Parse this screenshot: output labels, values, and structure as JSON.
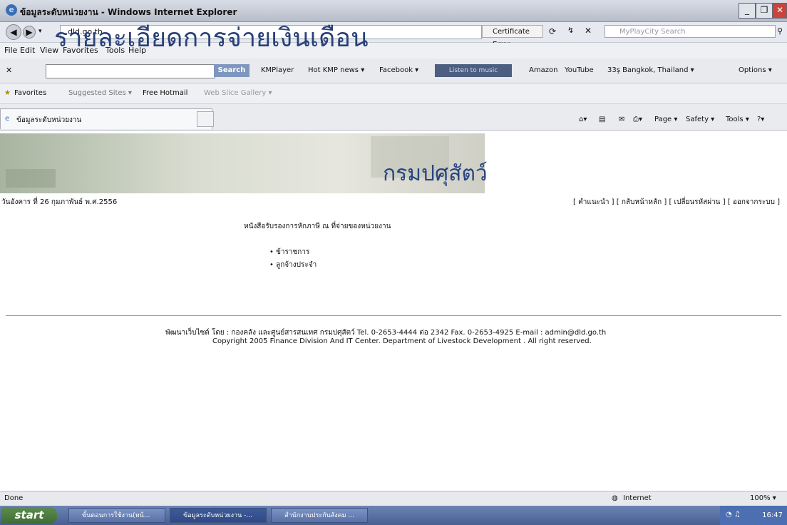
{
  "window": {
    "title": "ข้อมูลระดับหน่วยงาน - Windows Internet Explorer",
    "minimize": "_",
    "restore": "❐",
    "close": "✕"
  },
  "address_bar": {
    "url": "dld.go.th",
    "cert_error": "Certificate Error",
    "search_placeholder": "MyPlayCity Search"
  },
  "menu": [
    "File",
    "Edit",
    "View",
    "Favorites",
    "Tools",
    "Help"
  ],
  "toolbar": {
    "search_button": "Search",
    "items": [
      "KMPlayer",
      "Hot KMP news ▾",
      "Facebook ▾"
    ],
    "listen": "Listen to music",
    "items2": [
      "Amazon",
      "YouTube",
      "33ş Bangkok, Thailand ▾"
    ],
    "options": "Options ▾"
  },
  "favorites_bar": {
    "favorites": "Favorites",
    "suggested": "Suggested Sites ▾",
    "hotmail": "Free Hotmail",
    "gallery": "Web Slice Gallery ▾"
  },
  "tab": {
    "label": "ข้อมูลระดับหน่วยงาน"
  },
  "command_bar": [
    "Page ▾",
    "Safety ▾",
    "Tools ▾"
  ],
  "page": {
    "banner_title": "รายละเอียดการจ่ายเงินเดือน",
    "banner_dept": "กรมปศุสัตว์",
    "date": "วันอังคาร ที่ 26 กุมภาพันธ์ พ.ศ.2556",
    "links": [
      "[ คำแนะนำ ]",
      "[ กลับหน้าหลัก ]",
      "[ เปลี่ยนรหัสผ่าน ]",
      "[ ออกจากระบบ ]"
    ],
    "heading": "หนังสือรับรองการหักภาษี ณ ที่จ่ายของหน่วยงาน",
    "items": [
      "ข้าราชการ",
      "ลูกจ้างประจำ"
    ],
    "footer_line1": "พัฒนาเว็บไซต์ โดย : กองคลัง และศูนย์สารสนเทศ กรมปศุสัตว์ Tel. 0-2653-4444 ต่อ 2342 Fax. 0-2653-4925 E-mail : admin@dld.go.th",
    "footer_line2": "Copyright 2005 Finance Division And IT Center. Department of Livestock Development . All right reserved."
  },
  "status_bar": {
    "status": "Done",
    "zone": "Internet",
    "zoom": "100% ▾"
  },
  "taskbar": {
    "start": "start",
    "tasks": [
      "ขั้นตอนการใช้งาน(หน้...",
      "ข้อมูลระดับหน่วยงาน -...",
      "สำนักงานประกันสังคม ..."
    ],
    "clock": "16:47"
  }
}
